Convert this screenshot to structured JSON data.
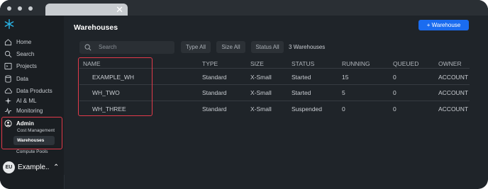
{
  "window": {
    "tab_close": "✕"
  },
  "sidebar": {
    "items": [
      {
        "label": "Home",
        "icon": "home-icon"
      },
      {
        "label": "Search",
        "icon": "search-icon"
      },
      {
        "label": "Projects",
        "icon": "projects-icon"
      },
      {
        "label": "Data",
        "icon": "database-icon"
      },
      {
        "label": "Data Products",
        "icon": "cloud-icon"
      },
      {
        "label": "AI & ML",
        "icon": "sparkle-icon"
      },
      {
        "label": "Monitoring",
        "icon": "activity-icon"
      }
    ],
    "admin": {
      "label": "Admin",
      "sub": [
        "Cost Management",
        "Warehouses",
        "Compute Pools"
      ]
    },
    "account": {
      "initials": "EU",
      "name": "Example..",
      "chevron": "⌃"
    }
  },
  "main": {
    "title": "Warehouses",
    "add_button": "+ Warehouse",
    "search_placeholder": "Search",
    "filters": [
      "Type All",
      "Size All",
      "Status All"
    ],
    "count": "3 Warehouses",
    "columns": [
      "NAME",
      "TYPE",
      "SIZE",
      "STATUS",
      "RUNNING",
      "QUEUED",
      "OWNER"
    ],
    "rows": [
      [
        "EXAMPLE_WH",
        "Standard",
        "X-Small",
        "Started",
        "15",
        "0",
        "ACCOUNT"
      ],
      [
        "WH_TWO",
        "Standard",
        "X-Small",
        "Started",
        "5",
        "0",
        "ACCOUNT"
      ],
      [
        "WH_THREE",
        "Standard",
        "X-Small",
        "Suspended",
        "0",
        "0",
        "ACCOUNT"
      ]
    ]
  }
}
